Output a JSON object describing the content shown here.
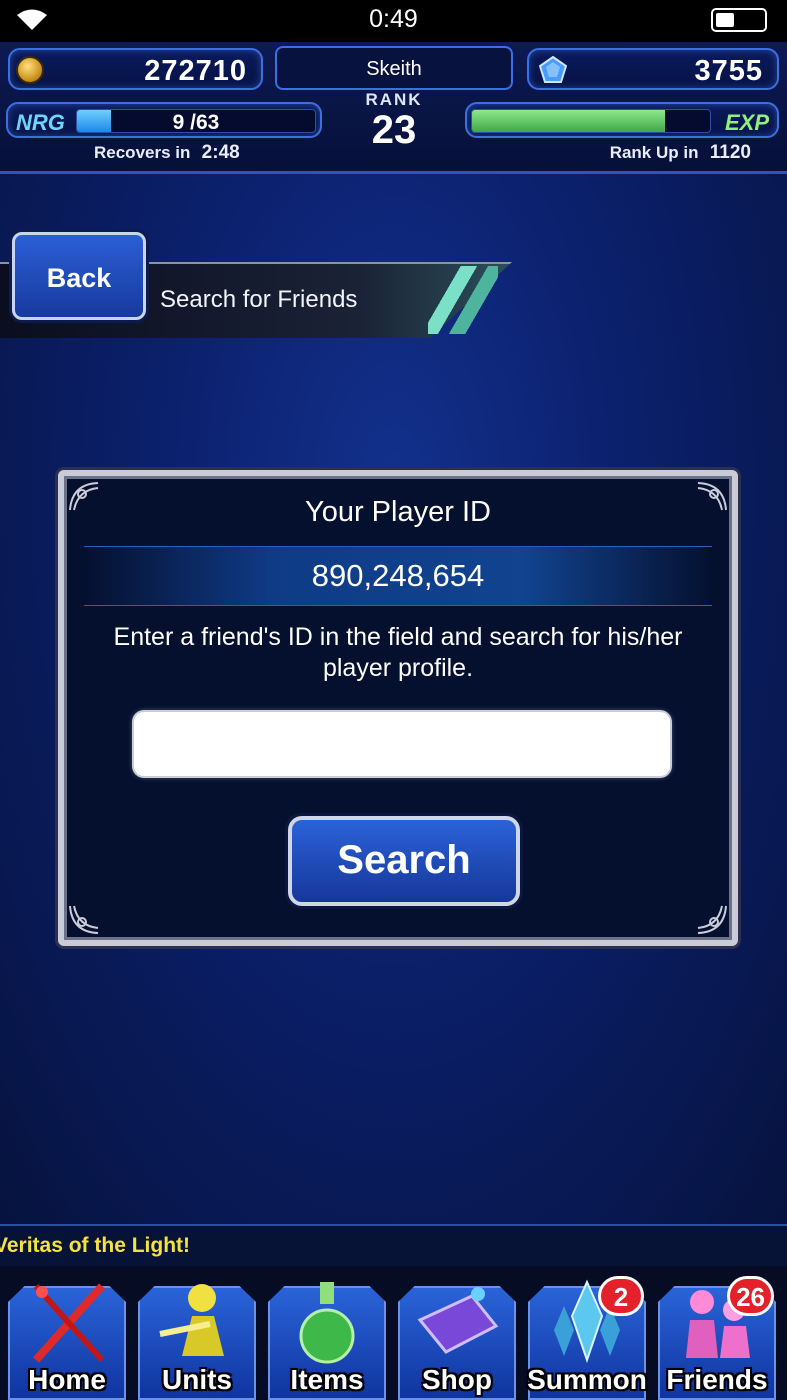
{
  "status_bar": {
    "time": "0:49",
    "wifi_icon": "wifi-icon",
    "battery_icon": "battery-icon",
    "battery_level": 0.35
  },
  "hud": {
    "gil": "272710",
    "gems": "3755",
    "player_name": "Skeith",
    "rank_label": "RANK",
    "rank": "23",
    "nrg_label": "NRG",
    "nrg_value": "9 /63",
    "nrg_fill": 0.143,
    "recovers_label": "Recovers in",
    "recovers_time": "2:48",
    "exp_label": "EXP",
    "exp_fill": 0.81,
    "rankup_label": "Rank Up in",
    "rankup_value": "1120"
  },
  "header": {
    "back_label": "Back",
    "title": "Search for Friends"
  },
  "panel": {
    "heading": "Your Player ID",
    "player_id": "890,248,654",
    "description": "Enter a friend's ID in the field and search for his/her player profile.",
    "input_value": "",
    "search_label": "Search"
  },
  "ticker": {
    "text": "Veritas of the Light!"
  },
  "nav": {
    "items": [
      {
        "label": "Home",
        "icon": "sword-icon"
      },
      {
        "label": "Units",
        "icon": "unit-icon"
      },
      {
        "label": "Items",
        "icon": "potion-icon"
      },
      {
        "label": "Shop",
        "icon": "shop-icon"
      },
      {
        "label": "Summon",
        "icon": "crystal-icon",
        "badge": "2"
      },
      {
        "label": "Friends",
        "icon": "friends-icon",
        "badge": "26"
      }
    ]
  },
  "colors": {
    "accent": "#2b62d8",
    "background": "#0b1f6a",
    "ticker_text": "#f6e23c",
    "badge": "#e4202a"
  }
}
